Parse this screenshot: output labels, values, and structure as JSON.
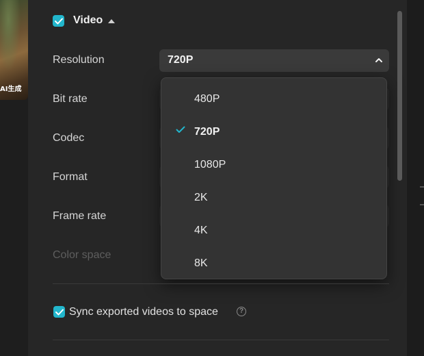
{
  "thumbnail": {
    "label": "AI生成"
  },
  "video_section": {
    "title": "Video",
    "checked": true
  },
  "settings": {
    "resolution_label": "Resolution",
    "resolution_value": "720P",
    "bitrate_label": "Bit rate",
    "codec_label": "Codec",
    "format_label": "Format",
    "framerate_label": "Frame rate",
    "colorspace_label": "Color space"
  },
  "resolution_options": [
    "480P",
    "720P",
    "1080P",
    "2K",
    "4K",
    "8K"
  ],
  "selected_option": "720P",
  "sync": {
    "label": "Sync exported videos to space",
    "checked": true,
    "help_icon": "?"
  },
  "colors": {
    "accent": "#22b6cc",
    "background": "#262626",
    "dropdown_bg": "#333333"
  }
}
